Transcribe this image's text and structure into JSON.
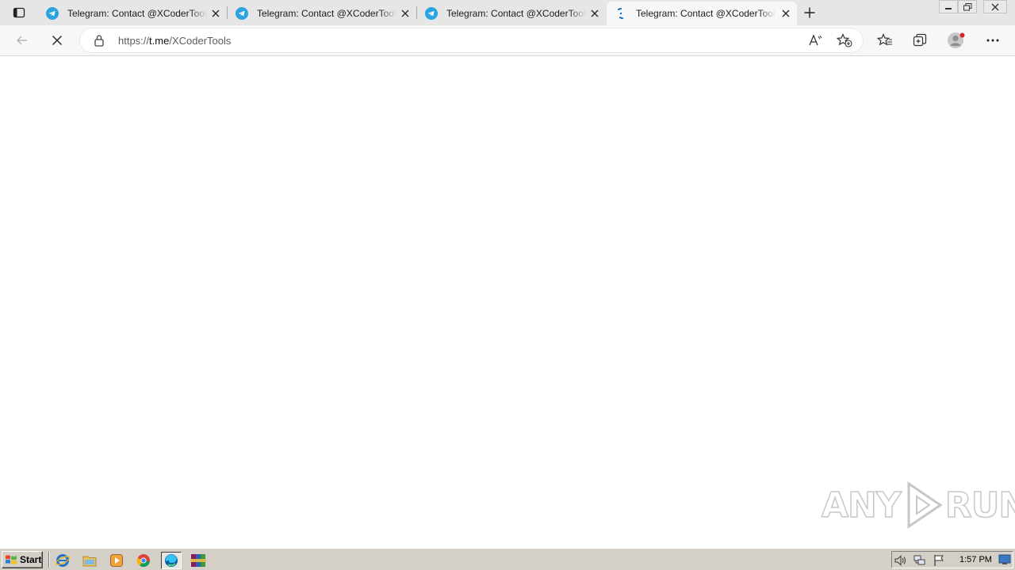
{
  "browser": {
    "tabs": [
      {
        "title": "Telegram: Contact @XCoderTools",
        "state": "loaded",
        "active": false
      },
      {
        "title": "Telegram: Contact @XCoderTools",
        "state": "loaded",
        "active": false
      },
      {
        "title": "Telegram: Contact @XCoderTools",
        "state": "loaded",
        "active": false
      },
      {
        "title": "Telegram: Contact @XCoderTools",
        "state": "loading",
        "active": true
      }
    ],
    "address": {
      "scheme": "https://",
      "host": "t.me",
      "path": "/XCoderTools"
    }
  },
  "watermark": {
    "text_left": "ANY",
    "text_right": "RUN"
  },
  "taskbar": {
    "start_label": "Start",
    "quick_launch": [
      "ie-icon",
      "explorer-folder-icon",
      "media-player-icon",
      "chrome-icon",
      "edge-icon",
      "winrar-icon"
    ],
    "clock": "1:57 PM"
  },
  "colors": {
    "telegram_blue": "#2aa3e0",
    "edge_accent": "#0f6cbd",
    "tabstrip_bg": "#e6e6e6",
    "taskbar_bg": "#d4d0c8"
  }
}
